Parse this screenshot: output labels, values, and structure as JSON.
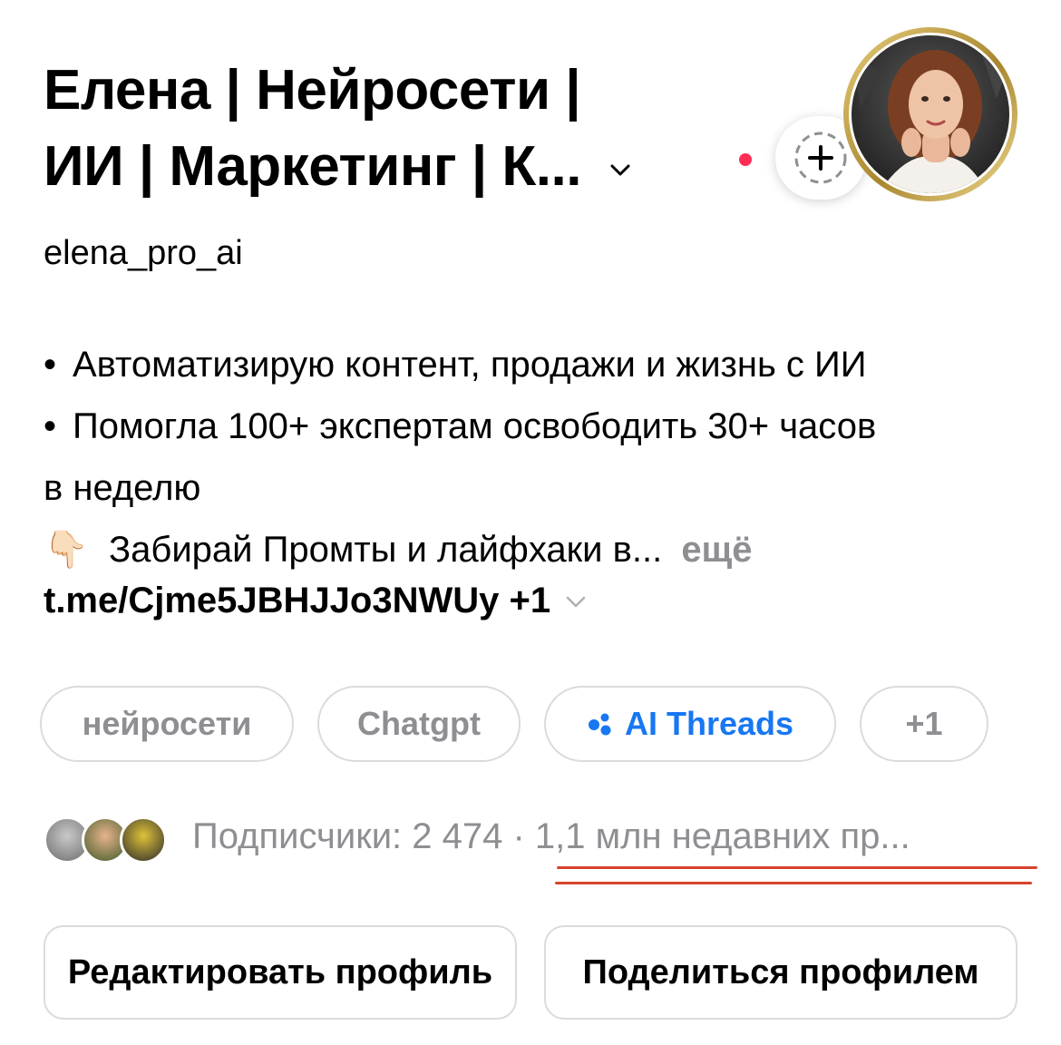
{
  "profile": {
    "name_line1": "Елена | Нейросети |",
    "name_line2": "ИИ | Маркетинг | К...",
    "username": "elena_pro_ai"
  },
  "bio": {
    "line1": "Автоматизирую контент, продажи и жизнь с ИИ",
    "line2": "Помогла 100+ экспертам освободить 30+ часов",
    "line3": "в неделю",
    "line4_emoji": "👇🏻",
    "line4": "Забирай Промты и лайфхаки в...",
    "more": "ещё",
    "bullet": "•"
  },
  "link": {
    "text": "t.me/Cjme5JBHJJo3NWUy +1"
  },
  "chips": [
    {
      "label": "нейросети"
    },
    {
      "label": "Chatgpt"
    },
    {
      "label": "AI Threads"
    },
    {
      "label": "+1"
    }
  ],
  "followers": {
    "text": "Подписчики: 2 474 · 1,1 млн недавних пр..."
  },
  "buttons": {
    "edit": "Редактировать профиль",
    "share": "Поделиться профилем"
  },
  "colors": {
    "accent_blue": "#1877f2",
    "notification_red": "#ff2d55",
    "annotation_red": "#d8432c",
    "muted_gray": "#8e8e93"
  },
  "icons": {
    "dropdown": "chevron-down-icon",
    "add_story": "plus-icon",
    "threads_chip": "threads-dots-icon"
  }
}
